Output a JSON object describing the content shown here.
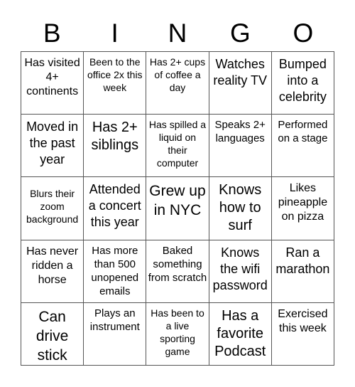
{
  "header": {
    "letters": [
      "B",
      "I",
      "N",
      "G",
      "O"
    ]
  },
  "board": {
    "rows": [
      [
        "Has visited 4+ continents",
        "Been to the office 2x this week",
        "Has 2+ cups of coffee a day",
        "Watches reality TV",
        "Bumped into a celebrity"
      ],
      [
        "Moved in the past year",
        "Has 2+ siblings",
        "Has spilled a liquid on their computer",
        "Speaks 2+ languages",
        "Performed on a stage"
      ],
      [
        "Blurs their zoom background",
        "Attended a concert this year",
        "Grew up in NYC",
        "Knows how to surf",
        "Likes pineapple on pizza"
      ],
      [
        "Has never ridden a horse",
        "Has more than 500 unopened emails",
        "Baked something from scratch",
        "Knows the wifi password",
        "Ran a marathon"
      ],
      [
        "Can drive stick",
        "Plays an instrument",
        "Has been to a live sporting game",
        "Has a favorite Podcast",
        "Exercised this week"
      ]
    ]
  }
}
